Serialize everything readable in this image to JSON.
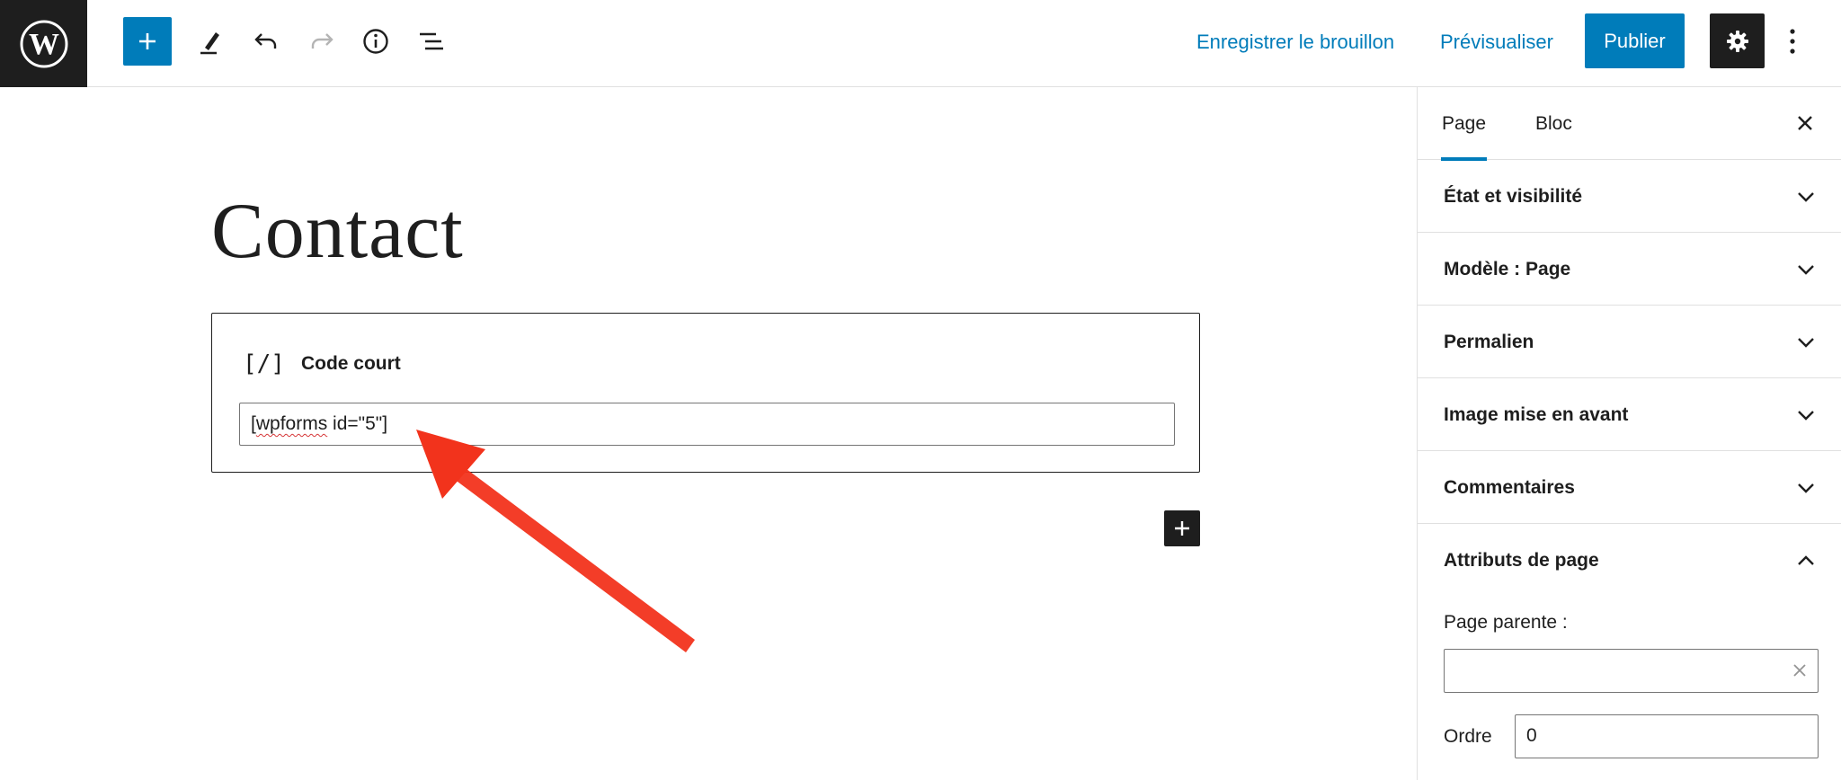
{
  "app": {
    "logo": "wordpress-logo"
  },
  "toolbar": {
    "add_icon": "plus-icon",
    "tools_icon": "pencil-icon",
    "undo_icon": "undo-icon",
    "redo_icon": "redo-icon",
    "details_icon": "info-icon",
    "outline_icon": "list-view-icon",
    "save_draft_label": "Enregistrer le brouillon",
    "preview_label": "Prévisualiser",
    "publish_label": "Publier",
    "settings_icon": "gear-icon",
    "more_icon": "vertical-dots-icon"
  },
  "editor": {
    "title": "Contact",
    "shortcode_block": {
      "icon_text": "[/]",
      "label": "Code court",
      "value_part1": "[",
      "value_misspelled": "wpforms",
      "value_part2": " id=\"5\"]"
    },
    "inserter_icon": "plus-icon",
    "annotation_arrow_color": "#f2331c"
  },
  "sidebar": {
    "tabs": [
      {
        "label": "Page",
        "active": true
      },
      {
        "label": "Bloc",
        "active": false
      }
    ],
    "close_icon": "close-icon",
    "panels": [
      {
        "title": "État et visibilité",
        "expanded": false
      },
      {
        "title": "Modèle : Page",
        "expanded": false
      },
      {
        "title": "Permalien",
        "expanded": false
      },
      {
        "title": "Image mise en avant",
        "expanded": false
      },
      {
        "title": "Commentaires",
        "expanded": false
      },
      {
        "title": "Attributs de page",
        "expanded": true
      }
    ],
    "page_attributes": {
      "parent_label": "Page parente :",
      "parent_value": "",
      "order_label": "Ordre",
      "order_value": "0"
    }
  },
  "colors": {
    "accent": "#007cba",
    "dark": "#1e1e1e",
    "border": "#e0e0e0"
  }
}
